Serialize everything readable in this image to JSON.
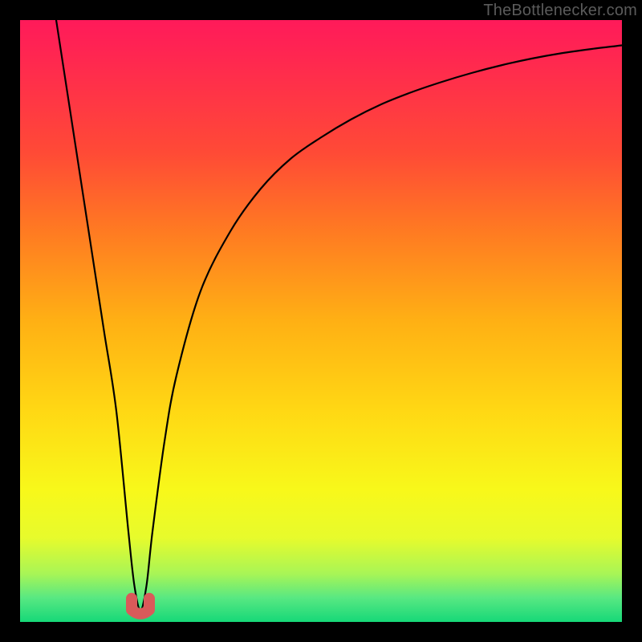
{
  "watermark": "TheBottlenecker.com",
  "chart_data": {
    "type": "line",
    "title": "",
    "xlabel": "",
    "ylabel": "",
    "xlim": [
      0,
      100
    ],
    "ylim": [
      0,
      100
    ],
    "notes": "Background is a vertical smooth gradient from red/magenta (top) through orange and yellow to green (bottom). A single black curve with a sharp V-shaped dip near x≈20 reaching y≈0, with a small pink/red rounded marker at the trough base.",
    "series": [
      {
        "name": "curve",
        "x": [
          6,
          8,
          10,
          12,
          14,
          16,
          18,
          19,
          20,
          21,
          22,
          24,
          26,
          30,
          35,
          40,
          45,
          50,
          55,
          60,
          65,
          70,
          75,
          80,
          85,
          90,
          95,
          100
        ],
        "y": [
          100,
          87,
          74,
          61,
          48,
          35,
          15,
          6,
          2,
          6,
          15,
          30,
          41,
          55,
          65,
          72,
          77,
          80.5,
          83.5,
          86,
          88,
          89.7,
          91.2,
          92.5,
          93.6,
          94.5,
          95.2,
          95.8
        ]
      }
    ],
    "gradient_stops": [
      {
        "offset": 0.0,
        "color": "#ff1a5a"
      },
      {
        "offset": 0.1,
        "color": "#ff2f4a"
      },
      {
        "offset": 0.22,
        "color": "#ff4a36"
      },
      {
        "offset": 0.35,
        "color": "#ff7a22"
      },
      {
        "offset": 0.5,
        "color": "#ffb014"
      },
      {
        "offset": 0.65,
        "color": "#ffd814"
      },
      {
        "offset": 0.78,
        "color": "#f8f81a"
      },
      {
        "offset": 0.86,
        "color": "#e7fb2c"
      },
      {
        "offset": 0.92,
        "color": "#a8f556"
      },
      {
        "offset": 0.96,
        "color": "#58e882"
      },
      {
        "offset": 1.0,
        "color": "#16d878"
      }
    ],
    "trough_marker": {
      "x": 20,
      "y": 1.5,
      "color": "#d95a5a"
    }
  }
}
